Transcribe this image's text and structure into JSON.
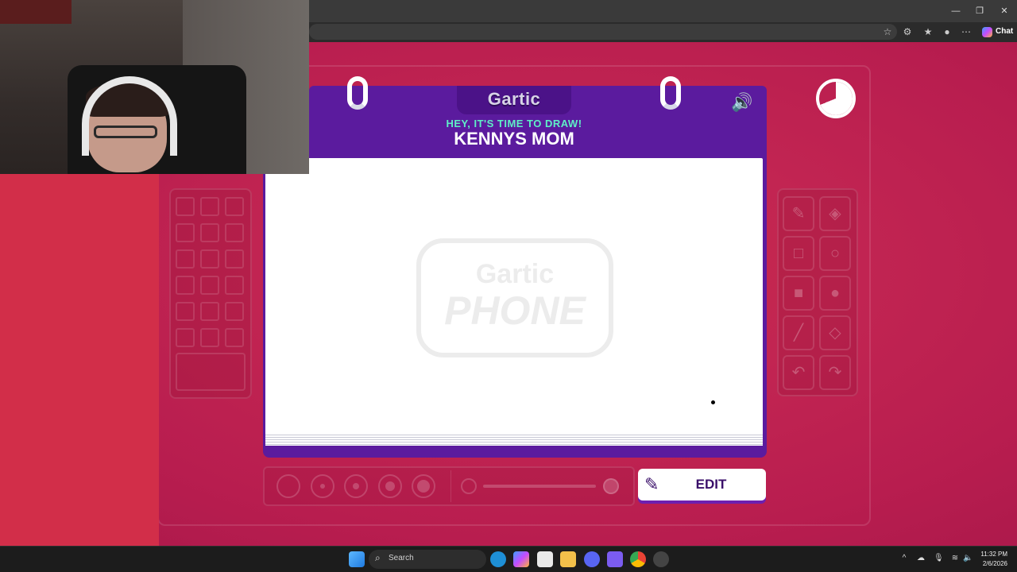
{
  "browser": {
    "minimize_glyph": "—",
    "restore_glyph": "❐",
    "close_glyph": "✕",
    "chat_label": "Chat"
  },
  "game": {
    "logo": "Gartic",
    "prompt_sub": "HEY, IT'S TIME TO DRAW!",
    "prompt_word": "KENNYS MOM",
    "watermark_top": "Gartic",
    "watermark_bottom": "PHONE",
    "edit_label": "EDIT",
    "timer_fraction": 0.69
  },
  "tools": [
    "pencil-icon",
    "eraser-icon",
    "rectangle-outline-icon",
    "ellipse-outline-icon",
    "rectangle-fill-icon",
    "ellipse-fill-icon",
    "line-icon",
    "bucket-icon",
    "undo-icon",
    "redo-icon"
  ],
  "taskbar": {
    "search_label": "Search",
    "time": "11:32 PM",
    "date": "2/6/2026"
  },
  "colors": {
    "accent_purple": "#5b1b9e",
    "prompt_green": "#5ff0c7",
    "background_red": "#c22552"
  }
}
